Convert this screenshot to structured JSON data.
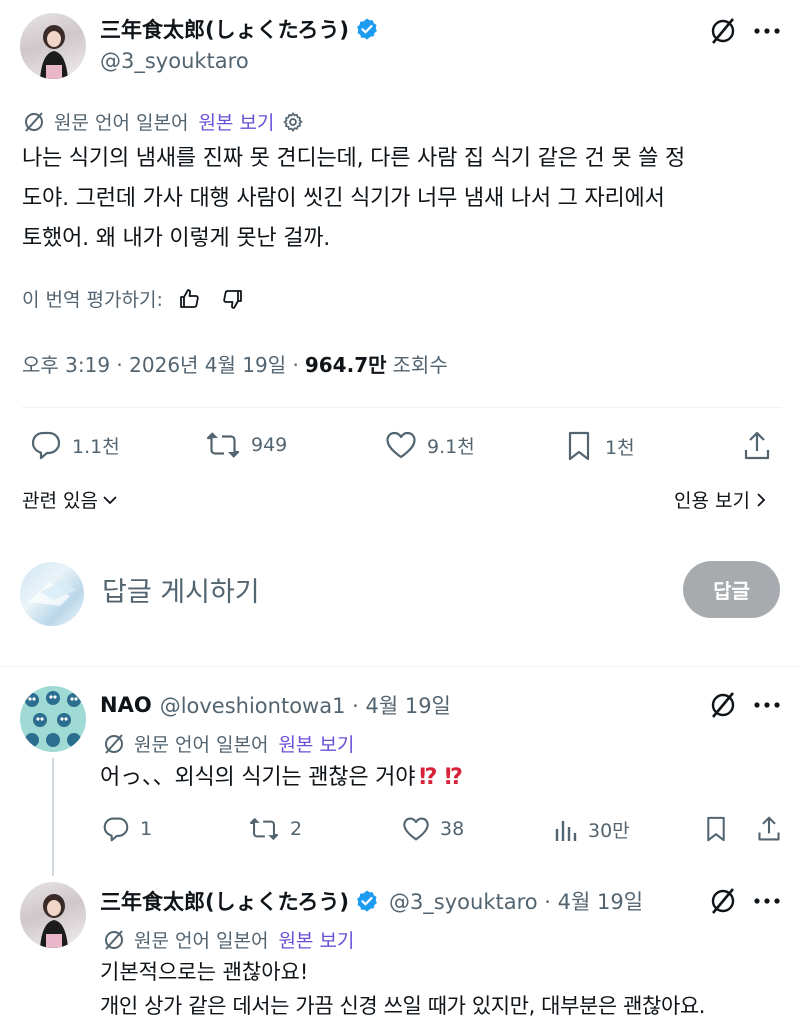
{
  "tweet": {
    "display_name": "三年食太郎(しょくたろう)",
    "handle": "@3_syouktaro",
    "translation_note": "원문 언어 일본어",
    "view_original": "원본 보기",
    "body_lines": [
      "나는 식기의 냄새를 진짜 못 견디는데, 다른 사람 집 식기 같은 건 못 쓸 정",
      "도야. 그런데 가사 대행 사람이 씻긴 식기가 너무 냄새 나서 그 자리에서",
      "토했어. 왜 내가 이렇게 못난 걸까."
    ],
    "rate_translation": "이 번역 평가하기:",
    "timestamp": "오후 3:19 · 2026년 4월 19일 ·",
    "views_count": "964.7만",
    "views_label": "조회수",
    "stats": {
      "replies": "1.1천",
      "reposts": "949",
      "likes": "9.1천",
      "bookmarks": "1천"
    },
    "related": "관련 있음",
    "quotes": "인용 보기"
  },
  "compose": {
    "placeholder": "답글 게시하기",
    "button": "답글"
  },
  "replies": [
    {
      "display_name": "NAO",
      "handle": "@loveshiontowa1 · 4월 19일",
      "translation_note": "원문 언어 일본어",
      "view_original": "원본 보기",
      "text": "어っ、、외식의 식기는 괜찮은 거야",
      "emoji": "⁉ ⁉",
      "stats": {
        "replies": "1",
        "reposts": "2",
        "likes": "38",
        "views": "30만"
      }
    },
    {
      "display_name": "三年食太郎(しょくたろう)",
      "handle": "@3_syouktaro · 4월 19일",
      "translation_note": "원문 언어 일본어",
      "view_original": "원본 보기",
      "text_lines": [
        "기본적으로는 괜찮아요!",
        "개인 상가 같은 데서는 가끔 신경 쓰일 때가 있지만, 대부분은 괜찮아요."
      ]
    }
  ],
  "colors": {
    "verified": "#1d9bf0",
    "link_purple": "#6b4fd8",
    "muted": "#536471",
    "emoji_red": "#d6243a"
  }
}
